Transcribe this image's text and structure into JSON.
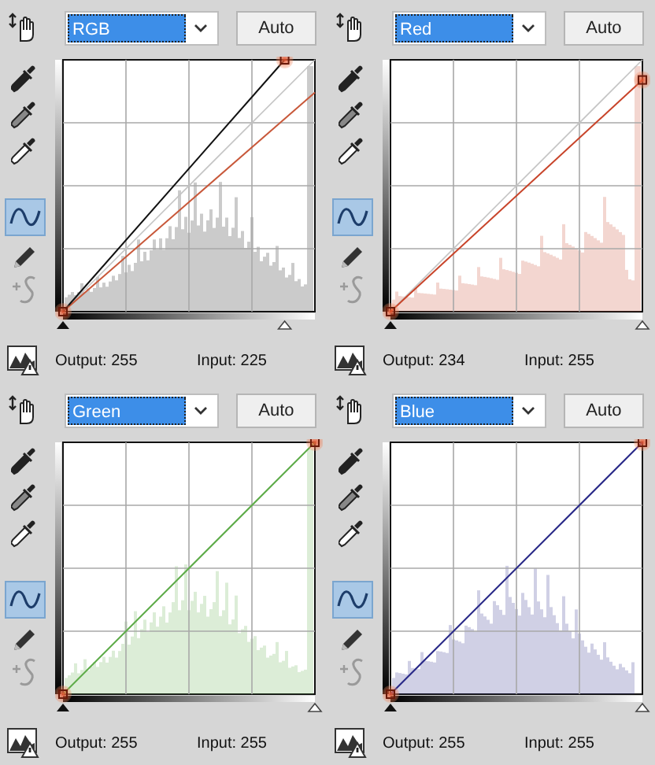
{
  "panels": [
    {
      "channel": "RGB",
      "auto_button": "Auto",
      "color": "#111111",
      "highlight_spike": true,
      "black_input": {
        "level": 0
      },
      "white_input": {
        "level": 0.88
      },
      "white_output": {
        "level": 1
      },
      "overlays": [
        {
          "color": "#c8583a",
          "level": 0.87
        }
      ],
      "output": "Output: 255",
      "input": "Input: 225"
    },
    {
      "channel": "Red",
      "auto_button": "Auto",
      "color": "#c8442a",
      "highlight_spike": true,
      "black_input": {
        "level": 0
      },
      "white_input": {
        "level": 1
      },
      "white_output": {
        "level": 0.92
      },
      "output": "Output: 234",
      "input": "Input: 255"
    },
    {
      "channel": "Green",
      "auto_button": "Auto",
      "color": "#5fae4a",
      "highlight_spike": true,
      "black_input": {
        "level": 0
      },
      "white_input": {
        "level": 1
      },
      "white_output": {
        "level": 1
      },
      "output": "Output: 255",
      "input": "Input: 255"
    },
    {
      "channel": "Blue",
      "auto_button": "Auto",
      "color": "#2a2a8a",
      "highlight_spike": false,
      "black_input": {
        "level": 0
      },
      "white_input": {
        "level": 1
      },
      "white_output": {
        "level": 1
      },
      "output": "Output: 255",
      "input": "Input: 255"
    }
  ]
}
